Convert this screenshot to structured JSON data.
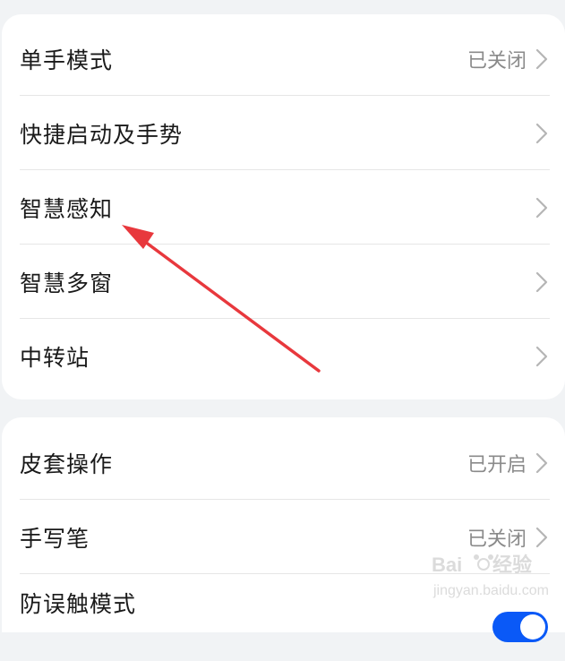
{
  "groups": [
    {
      "items": [
        {
          "label": "单手模式",
          "status": "已关闭"
        },
        {
          "label": "快捷启动及手势",
          "status": ""
        },
        {
          "label": "智慧感知",
          "status": ""
        },
        {
          "label": "智慧多窗",
          "status": ""
        },
        {
          "label": "中转站",
          "status": ""
        }
      ]
    },
    {
      "items": [
        {
          "label": "皮套操作",
          "status": "已开启"
        },
        {
          "label": "手写笔",
          "status": "已关闭"
        },
        {
          "label": "防误触模式",
          "status": "",
          "toggle": "on"
        }
      ]
    }
  ],
  "annotation": {
    "color": "#e8383d",
    "points_to": "智慧感知"
  },
  "accent_color": "#0a59f7",
  "watermark": "Baidu 经验 jingyan.baidu.com"
}
